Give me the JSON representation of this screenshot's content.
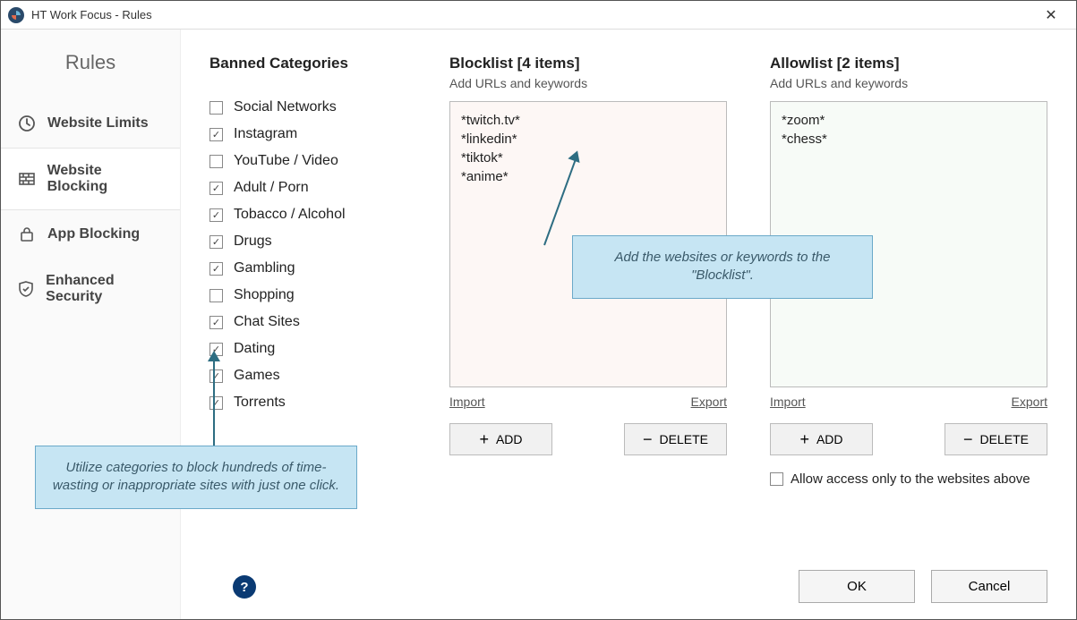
{
  "window": {
    "title": "HT Work Focus - Rules",
    "close_label": "✕"
  },
  "sidebar": {
    "title": "Rules",
    "items": [
      {
        "label": "Website Limits",
        "icon": "clock-icon",
        "active": false
      },
      {
        "label": "Website Blocking",
        "icon": "firewall-icon",
        "active": true
      },
      {
        "label": "App Blocking",
        "icon": "lock-icon",
        "active": false
      },
      {
        "label": "Enhanced Security",
        "icon": "shield-icon",
        "active": false
      }
    ]
  },
  "categories": {
    "title": "Banned Categories",
    "items": [
      {
        "label": "Social Networks",
        "checked": false
      },
      {
        "label": "Instagram",
        "checked": true
      },
      {
        "label": "YouTube / Video",
        "checked": false
      },
      {
        "label": "Adult / Porn",
        "checked": true
      },
      {
        "label": "Tobacco / Alcohol",
        "checked": true
      },
      {
        "label": "Drugs",
        "checked": true
      },
      {
        "label": "Gambling",
        "checked": true
      },
      {
        "label": "Shopping",
        "checked": false
      },
      {
        "label": "Chat Sites",
        "checked": true
      },
      {
        "label": "Dating",
        "checked": true
      },
      {
        "label": "Games",
        "checked": true
      },
      {
        "label": "Torrents",
        "checked": true
      }
    ]
  },
  "blocklist": {
    "title": "Blocklist [4 items]",
    "subtitle": "Add URLs and keywords",
    "items": [
      "*twitch.tv*",
      "*linkedin*",
      "*tiktok*",
      "*anime*"
    ],
    "import_label": "Import",
    "export_label": "Export",
    "add_label": "ADD",
    "delete_label": "DELETE"
  },
  "allowlist": {
    "title": "Allowlist [2 items]",
    "subtitle": "Add URLs and keywords",
    "items": [
      "*zoom*",
      "*chess*"
    ],
    "import_label": "Import",
    "export_label": "Export",
    "add_label": "ADD",
    "delete_label": "DELETE"
  },
  "allow_only": {
    "label": "Allow access only to the websites above",
    "checked": false
  },
  "buttons": {
    "ok": "OK",
    "cancel": "Cancel",
    "help": "?"
  },
  "annotations": {
    "categories_tip": "Utilize categories to block hundreds of time-wasting or inappropriate sites with just one click.",
    "blocklist_tip": "Add the websites or keywords to the \"Blocklist\"."
  }
}
